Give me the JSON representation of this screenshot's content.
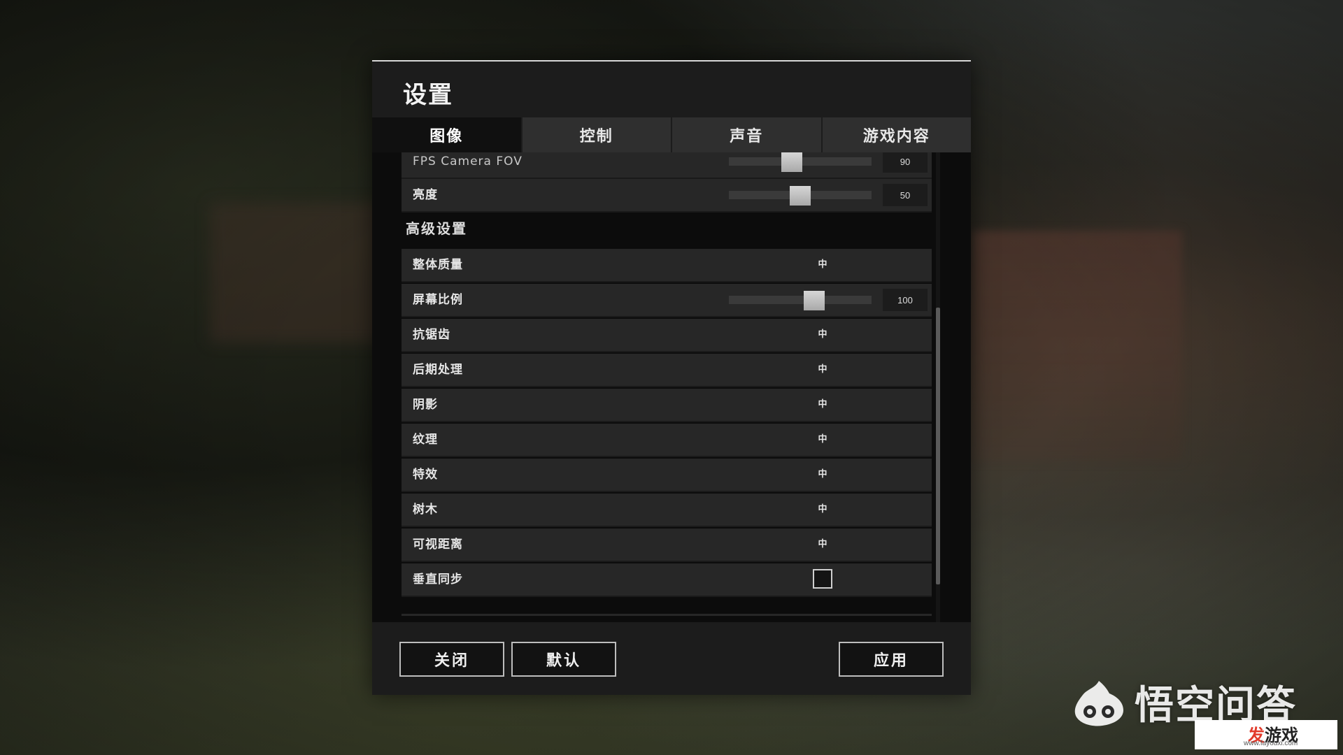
{
  "dialog": {
    "title": "设置"
  },
  "tabs": [
    {
      "label": "图像",
      "active": true
    },
    {
      "label": "控制",
      "active": false
    },
    {
      "label": "声音",
      "active": false
    },
    {
      "label": "游戏内容",
      "active": false
    }
  ],
  "basic": {
    "fov": {
      "label": "FPS Camera FOV",
      "value": "90",
      "fraction": 0.44
    },
    "brightness": {
      "label": "亮度",
      "value": "50",
      "fraction": 0.5
    }
  },
  "advanced": {
    "section_title": "高级设置",
    "overall_quality": {
      "label": "整体质量",
      "value": "中"
    },
    "screen_scale": {
      "label": "屏幕比例",
      "value": "100",
      "fraction": 0.6
    },
    "anti_aliasing": {
      "label": "抗锯齿",
      "value": "中"
    },
    "post_processing": {
      "label": "后期处理",
      "value": "中"
    },
    "shadows": {
      "label": "阴影",
      "value": "中"
    },
    "textures": {
      "label": "纹理",
      "value": "中"
    },
    "effects": {
      "label": "特效",
      "value": "中"
    },
    "foliage": {
      "label": "树木",
      "value": "中"
    },
    "view_distance": {
      "label": "可视距离",
      "value": "中"
    },
    "vsync": {
      "label": "垂直同步",
      "checked": false
    }
  },
  "footer": {
    "close_label": "关闭",
    "default_label": "默认",
    "apply_label": "应用"
  },
  "watermark": {
    "brand": "悟空问答",
    "site_prefix": "发",
    "site_suffix": "游戏",
    "site_url": "www.fayouxi.com"
  }
}
